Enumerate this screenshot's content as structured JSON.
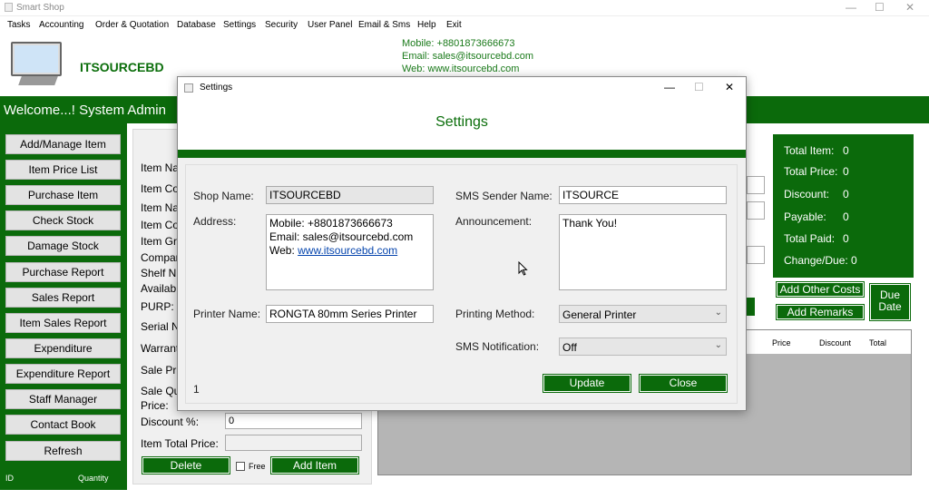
{
  "window": {
    "title": "Smart Shop",
    "minimize": "—",
    "maximize": "☐",
    "close": "✕"
  },
  "menu": [
    "Tasks",
    "Accounting",
    "Order & Quotation",
    "Database",
    "Settings",
    "Security",
    "User Panel",
    "Email & Sms",
    "Help",
    "Exit"
  ],
  "brand": {
    "name": "ITSOURCEBD",
    "mobile": "Mobile: +8801873666673",
    "email": "Email: sales@itsourcebd.com",
    "web": "Web: www.itsourcebd.com"
  },
  "welcome": "Welcome...! System Admin",
  "nav": [
    "Add/Manage Item",
    "Item Price List",
    "Purchase Item",
    "Check Stock",
    "Damage Stock",
    "Purchase Report",
    "Sales Report",
    "Item Sales Report",
    "Expenditure",
    "Expenditure Report",
    "Staff Manager",
    "Contact Book",
    "Refresh"
  ],
  "left_footer": {
    "id": "ID",
    "quantity": "Quantity"
  },
  "form": {
    "labels_partial": [
      "Item Na",
      "Item Co",
      "Item Na",
      "Item Co",
      "Item Gr",
      "Compan",
      "Shelf N",
      "Availab",
      "PURP:",
      "Serial N",
      "Warrant",
      "Sale Pri",
      "Sale Qu",
      "Price:"
    ],
    "discount_label": "Discount %:",
    "discount_value": "0",
    "total_label": "Item Total Price:",
    "total_value": "",
    "delete_btn": "Delete",
    "free_label": "Free",
    "add_item_btn": "Add Item"
  },
  "summary": {
    "total_item": "Total Item:",
    "total_item_val": "0",
    "total_price": "Total Price:",
    "total_price_val": "0",
    "discount": "Discount:",
    "discount_val": "0",
    "payable": "Payable:",
    "payable_val": "0",
    "total_paid": "Total Paid:",
    "total_paid_val": "0",
    "change_due": "Change/Due: 0"
  },
  "buttons": {
    "add_other_costs": "Add Other Costs",
    "add_remarks": "Add Remarks",
    "due_date_1": "Due",
    "due_date_2": "Date"
  },
  "table": {
    "columns": [
      "Price",
      "Discount",
      "Total"
    ]
  },
  "dialog": {
    "title": "Settings",
    "header": "Settings",
    "shop_name_label": "Shop Name:",
    "shop_name": "ITSOURCEBD",
    "address_label": "Address:",
    "address_line1": "Mobile: +8801873666673",
    "address_line2": "Email: sales@itsourcebd.com",
    "address_web_prefix": "Web: ",
    "address_web_link": "www.itsourcebd.com",
    "printer_label": "Printer Name:",
    "printer_value": "RONGTA 80mm Series Printer",
    "sms_sender_label": "SMS Sender Name:",
    "sms_sender": "ITSOURCE",
    "announcement_label": "Announcement:",
    "announcement": "Thank You!",
    "printing_method_label": "Printing Method:",
    "printing_method": "General Printer",
    "sms_notif_label": "SMS Notification:",
    "sms_notif": "Off",
    "footer_num": "1",
    "update_btn": "Update",
    "close_btn": "Close"
  },
  "colors": {
    "primary_green": "#0b6a0b",
    "brand_green": "#0b6e0b"
  }
}
